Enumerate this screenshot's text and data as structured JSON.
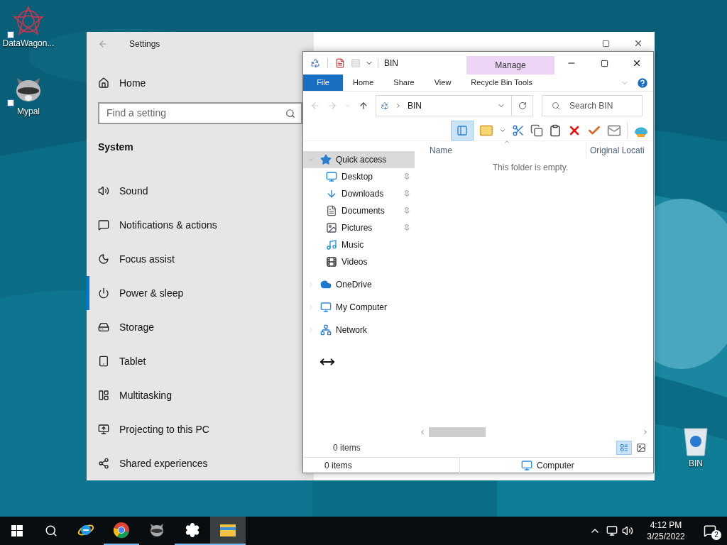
{
  "desktop_icons": [
    {
      "label": "DataWagon...",
      "kind": "datawagon"
    },
    {
      "label": "Mypal",
      "kind": "mypal"
    },
    {
      "label": "BIN",
      "kind": "bin"
    }
  ],
  "settings": {
    "title": "Settings",
    "home": "Home",
    "search": {
      "placeholder": "Find a setting"
    },
    "section": "System",
    "items": [
      {
        "label": "Sound",
        "kind": "sound",
        "selected": false
      },
      {
        "label": "Notifications & actions",
        "kind": "notifications",
        "selected": false
      },
      {
        "label": "Focus assist",
        "kind": "focus",
        "selected": false
      },
      {
        "label": "Power & sleep",
        "kind": "power",
        "selected": true
      },
      {
        "label": "Storage",
        "kind": "storage",
        "selected": false
      },
      {
        "label": "Tablet",
        "kind": "tablet",
        "selected": false
      },
      {
        "label": "Multitasking",
        "kind": "multitasking",
        "selected": false
      },
      {
        "label": "Projecting to this PC",
        "kind": "projecting",
        "selected": false
      },
      {
        "label": "Shared experiences",
        "kind": "shared",
        "selected": false
      }
    ]
  },
  "explorer": {
    "title": "BIN",
    "context_tab": "Manage",
    "ribbon_tabs": [
      {
        "label": "File",
        "kind": "file",
        "selected": false
      },
      {
        "label": "Home",
        "kind": "tab",
        "selected": false
      },
      {
        "label": "Share",
        "kind": "tab",
        "selected": false
      },
      {
        "label": "View",
        "kind": "tab",
        "selected": false
      },
      {
        "label": "Recycle Bin Tools",
        "kind": "tab",
        "selected": false
      }
    ],
    "address": "BIN",
    "search": {
      "placeholder": "Search BIN"
    },
    "columns": [
      "Name",
      "Original Locati"
    ],
    "empty_message": "This folder is empty.",
    "nav": [
      {
        "label": "Quick access",
        "kind": "star",
        "selected": true,
        "expanded": true,
        "children": [
          {
            "label": "Desktop",
            "kind": "desktop",
            "pinned": true
          },
          {
            "label": "Downloads",
            "kind": "downloads",
            "pinned": true
          },
          {
            "label": "Documents",
            "kind": "documents",
            "pinned": true
          },
          {
            "label": "Pictures",
            "kind": "pictures",
            "pinned": true
          },
          {
            "label": "Music",
            "kind": "music",
            "pinned": false
          },
          {
            "label": "Videos",
            "kind": "videos",
            "pinned": false
          }
        ]
      },
      {
        "label": "OneDrive",
        "kind": "cloud",
        "selected": false,
        "expanded": false
      },
      {
        "label": "My Computer",
        "kind": "computer",
        "selected": false,
        "expanded": false
      },
      {
        "label": "Network",
        "kind": "network",
        "selected": false,
        "expanded": false
      }
    ],
    "item_count": "0 items",
    "status": {
      "items": "0 items",
      "location": "Computer"
    }
  },
  "taskbar": {
    "apps": [
      {
        "kind": "ie",
        "running": false,
        "selected": false
      },
      {
        "kind": "chrome",
        "running": true,
        "selected": false
      },
      {
        "kind": "mypal",
        "running": false,
        "selected": false
      },
      {
        "kind": "settings",
        "running": true,
        "selected": false
      },
      {
        "kind": "explorer",
        "running": true,
        "selected": true
      }
    ],
    "time": "4:12 PM",
    "date": "3/25/2022",
    "notifications": "2"
  }
}
